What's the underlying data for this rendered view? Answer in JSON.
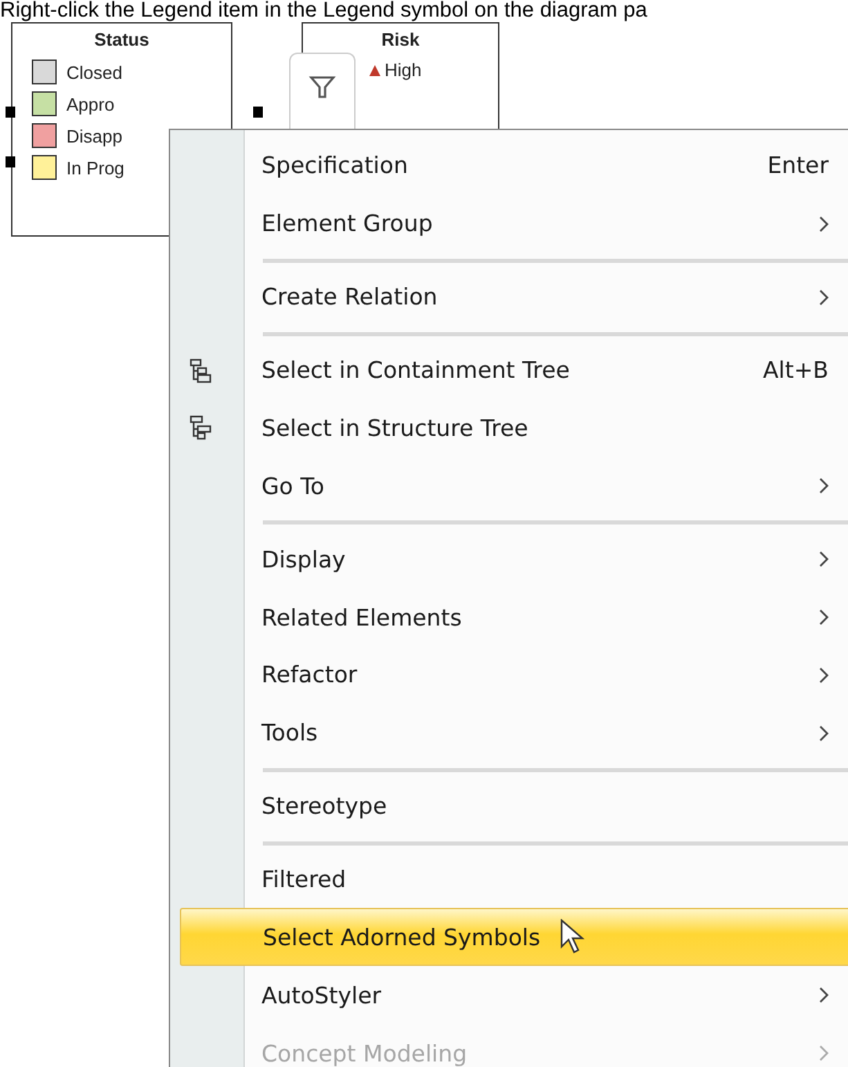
{
  "caption": "Right-click the Legend item in the Legend symbol on the diagram pa",
  "legends": [
    {
      "title": "Status",
      "items": [
        {
          "label": "Closed",
          "color": "#d9d9d9"
        },
        {
          "label": "Appro",
          "color": "#c6e0a4"
        },
        {
          "label": "Disapp",
          "color": "#f0a0a0"
        },
        {
          "label": "In Prog",
          "color": "#fff199"
        }
      ]
    },
    {
      "title": "Risk",
      "items": [
        {
          "label": "High",
          "color": "#c0392b"
        }
      ]
    }
  ],
  "menu": [
    {
      "kind": "item",
      "label": "Specification",
      "shortcut": "Enter",
      "submenu": false,
      "disabled": false,
      "selected": false
    },
    {
      "kind": "item",
      "label": "Element Group",
      "submenu": true,
      "disabled": false,
      "selected": false
    },
    {
      "kind": "separator"
    },
    {
      "kind": "item",
      "label": "Create Relation",
      "submenu": true,
      "disabled": false,
      "selected": false
    },
    {
      "kind": "separator"
    },
    {
      "kind": "containment-item",
      "label": "Select in Containment Tree",
      "shortcut": "Alt+B",
      "submenu": false,
      "disabled": false,
      "selected": false
    },
    {
      "kind": "structure-item",
      "label": "Select in Structure Tree",
      "submenu": false,
      "disabled": false,
      "selected": false
    },
    {
      "kind": "item",
      "label": "Go To",
      "submenu": true,
      "disabled": false,
      "selected": false
    },
    {
      "kind": "separator"
    },
    {
      "kind": "item",
      "label": "Display",
      "submenu": true,
      "disabled": false,
      "selected": false
    },
    {
      "kind": "item",
      "label": "Related Elements",
      "submenu": true,
      "disabled": false,
      "selected": false
    },
    {
      "kind": "item",
      "label": "Refactor",
      "submenu": true,
      "disabled": false,
      "selected": false
    },
    {
      "kind": "item",
      "label": "Tools",
      "submenu": true,
      "disabled": false,
      "selected": false
    },
    {
      "kind": "separator"
    },
    {
      "kind": "item",
      "label": "Stereotype",
      "submenu": false,
      "disabled": false,
      "selected": false
    },
    {
      "kind": "separator"
    },
    {
      "kind": "item",
      "label": "Filtered",
      "submenu": false,
      "disabled": false,
      "selected": false
    },
    {
      "kind": "item",
      "label": "Select Adorned Symbols",
      "submenu": false,
      "disabled": false,
      "selected": true
    },
    {
      "kind": "item",
      "label": "AutoStyler",
      "submenu": true,
      "disabled": false,
      "selected": false
    },
    {
      "kind": "item",
      "label": "Concept Modeling",
      "submenu": true,
      "disabled": true,
      "selected": false
    }
  ]
}
